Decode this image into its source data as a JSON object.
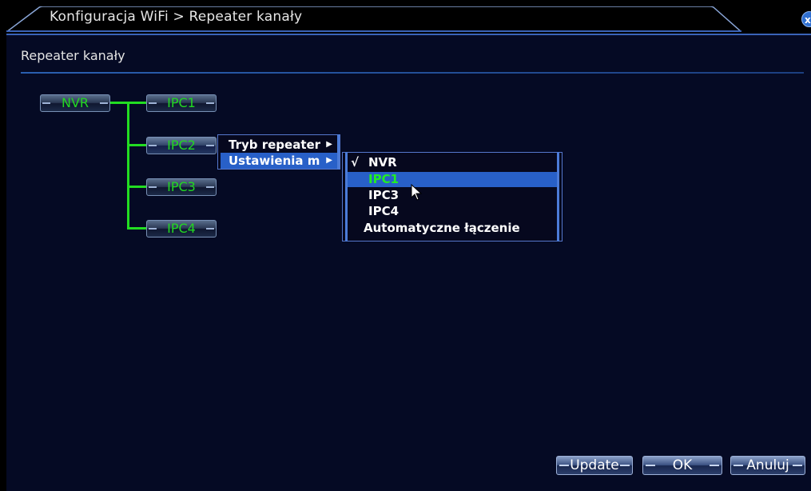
{
  "window": {
    "breadcrumb": "Konfiguracja WiFi > Repeater kanały",
    "close_icon": "x"
  },
  "panel": {
    "title": "Repeater kanały"
  },
  "tree": {
    "root": "NVR",
    "nodes": [
      "IPC1",
      "IPC2",
      "IPC3",
      "IPC4"
    ]
  },
  "context_menu": {
    "items": [
      {
        "label": "Tryb repeater"
      },
      {
        "label": "Ustawienia m"
      }
    ]
  },
  "submenu": {
    "items": [
      {
        "check": "√",
        "label": "NVR"
      },
      {
        "check": "",
        "label": "IPC1"
      },
      {
        "check": "",
        "label": "IPC3"
      },
      {
        "check": "",
        "label": "IPC4"
      },
      {
        "check": "",
        "label": "Automatyczne łączenie"
      }
    ]
  },
  "buttons": {
    "update": "Update",
    "ok": "OK",
    "cancel": "Anuluj"
  },
  "colors": {
    "tree_line": "#22dd22",
    "node_text": "#22d822",
    "highlight": "#2860c8",
    "panel_bg": "#050a24"
  }
}
